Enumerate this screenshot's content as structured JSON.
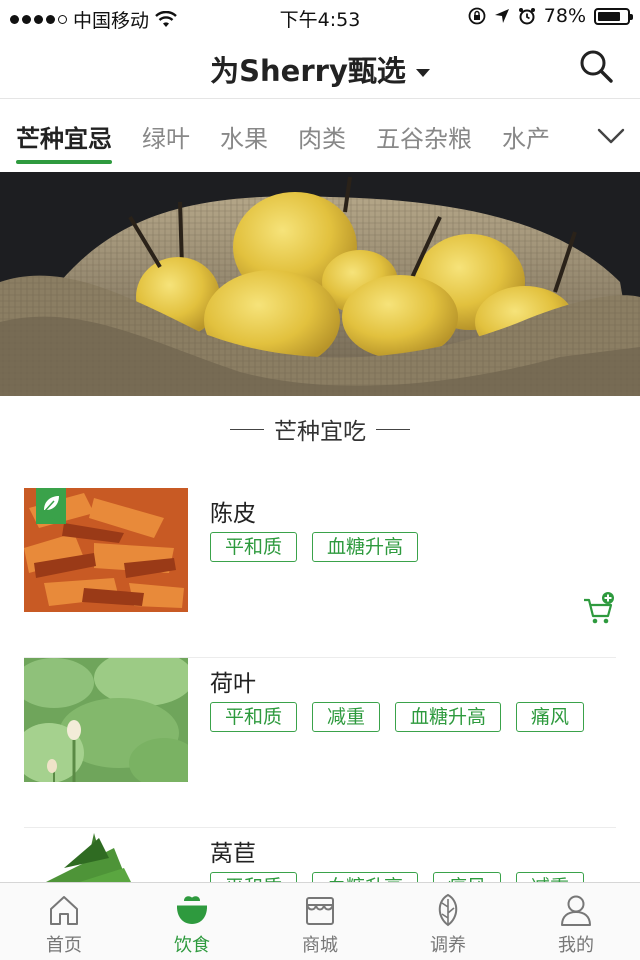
{
  "status_bar": {
    "carrier": "中国移动",
    "time": "下午4:53",
    "battery_percent": "78%",
    "battery_level": 0.78,
    "signal_bars": 4
  },
  "header": {
    "title": "为Sherry甄选",
    "search_icon": "search-icon",
    "dropdown_icon": "caret-down-icon"
  },
  "tabs": [
    {
      "label": "芒种宜忌",
      "active": true
    },
    {
      "label": "绿叶",
      "active": false
    },
    {
      "label": "水果",
      "active": false
    },
    {
      "label": "肉类",
      "active": false
    },
    {
      "label": "五谷杂粮",
      "active": false
    },
    {
      "label": "水产",
      "active": false
    }
  ],
  "section": {
    "title": "芒种宜吃"
  },
  "products": [
    {
      "name": "陈皮",
      "tags": [
        "平和质",
        "血糖升高"
      ]
    },
    {
      "name": "荷叶",
      "tags": [
        "平和质",
        "减重",
        "血糖升高",
        "痛风"
      ]
    },
    {
      "name": "莴苣",
      "tags": [
        "平和质",
        "血糖升高",
        "痛风",
        "减重"
      ]
    }
  ],
  "bottom_nav": [
    {
      "label": "首页",
      "icon": "home-icon",
      "active": false
    },
    {
      "label": "饮食",
      "icon": "bowl-icon",
      "active": true
    },
    {
      "label": "商城",
      "icon": "shop-icon",
      "active": false
    },
    {
      "label": "调养",
      "icon": "leaf-icon",
      "active": false
    },
    {
      "label": "我的",
      "icon": "user-icon",
      "active": false
    }
  ],
  "colors": {
    "accent": "#2e9a3e",
    "tag_border": "#3aa24a"
  }
}
